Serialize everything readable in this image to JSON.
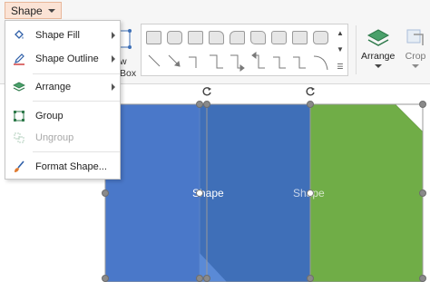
{
  "ribbon": {
    "tab_label": "Shape",
    "partial_button_lines": [
      "w",
      "Box"
    ],
    "arrange_label": "Arrange",
    "crop_label": "Crop"
  },
  "menu": {
    "items": [
      {
        "label": "Shape Fill",
        "icon": "paint-bucket-icon",
        "enabled": true,
        "submenu": true
      },
      {
        "label": "Shape Outline",
        "icon": "pencil-outline-icon",
        "enabled": true,
        "submenu": true
      },
      {
        "label": "Arrange",
        "icon": "layers-icon",
        "enabled": true,
        "submenu": true
      },
      {
        "label": "Group",
        "icon": "group-icon",
        "enabled": true,
        "submenu": false
      },
      {
        "label": "Ungroup",
        "icon": "ungroup-icon",
        "enabled": false,
        "submenu": false
      },
      {
        "label": "Format Shape...",
        "icon": "brush-icon",
        "enabled": true,
        "submenu": false
      }
    ]
  },
  "canvas": {
    "shapes": [
      {
        "label": "Shape",
        "fill": "#4a78c9"
      },
      {
        "label": "Shape",
        "fill": "#70ad47"
      }
    ]
  },
  "colors": {
    "tab_bg": "#fbe3d5",
    "blue_shape": "#4a78c9",
    "blue_shape_dark": "#3f6fb8",
    "green_shape": "#70ad47",
    "handle": "#8a8a8a"
  }
}
